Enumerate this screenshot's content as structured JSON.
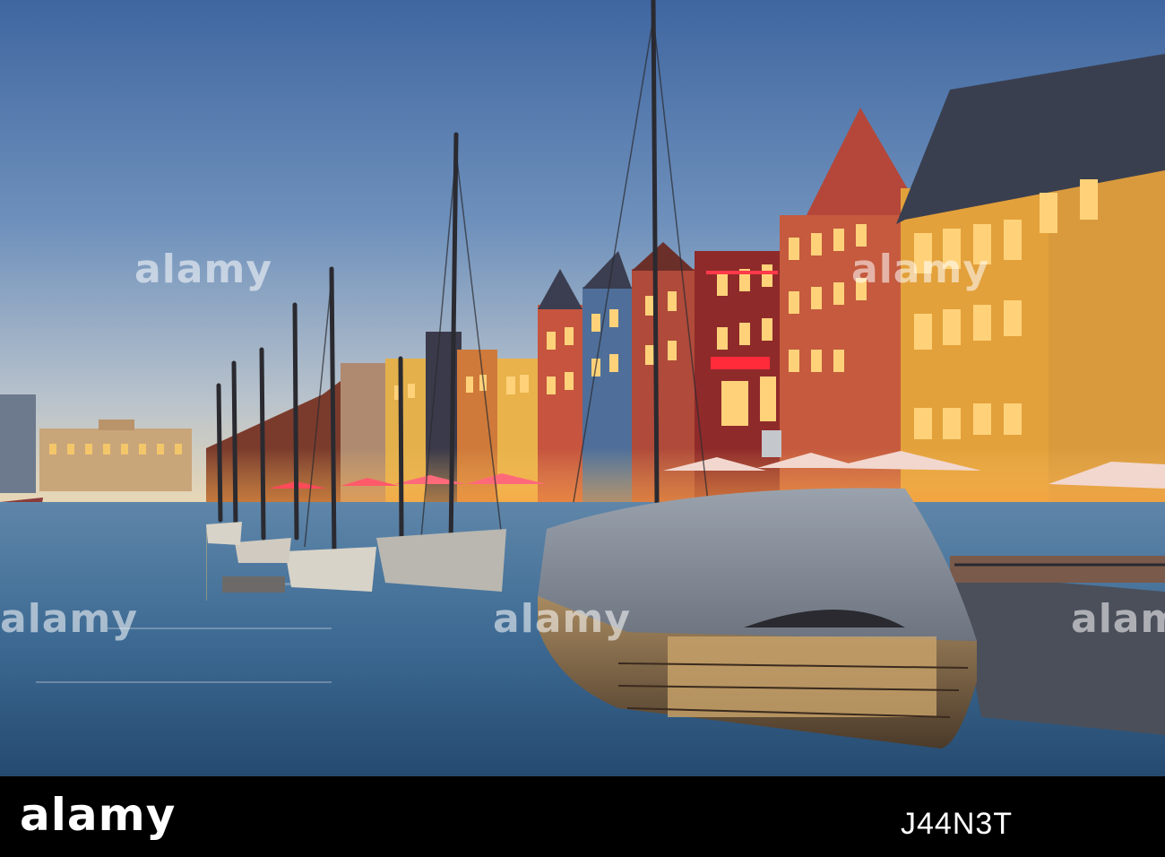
{
  "watermark": {
    "text": "alamy"
  },
  "footer": {
    "logo": "alamy",
    "image_id": "J44N3T"
  },
  "colors": {
    "sky_top": "#4a6fa3",
    "sky_bottom": "#d8d6c8",
    "water": "#3d6e98",
    "facade_yellow": "#e6a640",
    "facade_red": "#c0503a",
    "lamp_glow": "#ffc35a",
    "awning": "#e84a5f"
  }
}
